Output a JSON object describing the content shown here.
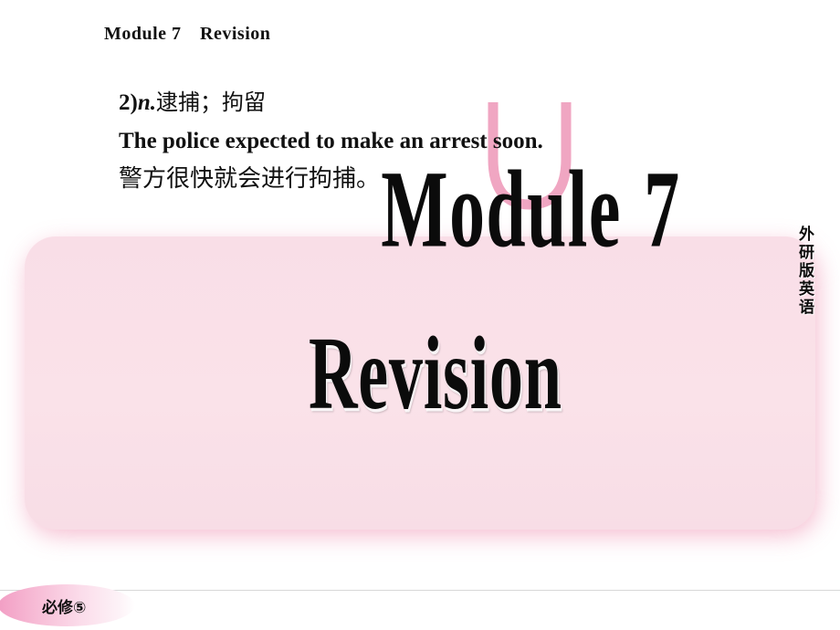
{
  "slide": {
    "header": "Module 7　Revision",
    "background_color": "#ffffff"
  },
  "content": {
    "line1_number": "2)",
    "line1_pos": "n.",
    "line1_cn": "逮捕；拘留",
    "line2_en": "The police expected to make an arrest soon.",
    "line3_cn": "警方很快就会进行拘捕。"
  },
  "wordart": {
    "module_word": "Module",
    "module_number": "7",
    "revision": "Revision",
    "arc_color": "#f0a6c2"
  },
  "panel": {
    "fill_color": "#f9dee7",
    "shadow_color": "#f2a6c0"
  },
  "side_label": {
    "chars": [
      "外",
      "研",
      "版",
      "英",
      "语"
    ]
  },
  "footer": {
    "badge_text": "必修⑤",
    "badge_gradient_start": "#f29ec4",
    "badge_gradient_end": "#ffffff"
  }
}
